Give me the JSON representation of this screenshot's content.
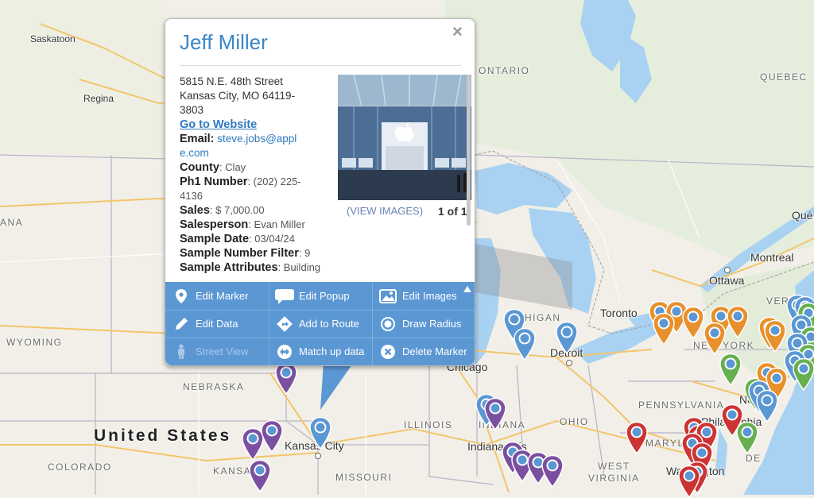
{
  "map": {
    "labels": {
      "saskatoon": "Saskatoon",
      "regina": "Regina",
      "ontario": "ONTARIO",
      "quebec": "QUEBEC",
      "que": "Qué",
      "montreal": "Montreal",
      "ottawa": "Ottawa",
      "toronto": "Toronto",
      "michigan": "HIGAN",
      "detroit": "Detroit",
      "chicago": "Chicago",
      "ver": "VER",
      "newyork": "NEW YORK",
      "wyoming": "WYOMING",
      "nebraska": "NEBRASKA",
      "ana": "ANA",
      "us": "United States",
      "colorado": "COLORADO",
      "kansas": "KANSA",
      "kansascity": "Kansas City",
      "missouri": "MISSOURI",
      "illinois": "ILLINOIS",
      "indiana": "INDIANA",
      "indianapolis": "Indianapolis",
      "ohio": "OHIO",
      "pennsylvania": "PENNSYLVANIA",
      "philadelphia": "Philadelphia",
      "maryland": "MARYLAND",
      "westvirginia_1": "WEST",
      "westvirginia_2": "VIRGINIA",
      "washington": "Washington",
      "ny_city": "Ne",
      "de": "DE"
    },
    "pin_colors": {
      "blue": "#5b97d3",
      "purple": "#7b4fa0",
      "orange": "#e8902c",
      "green": "#66b04f",
      "red": "#cc3333"
    }
  },
  "popup": {
    "title": "Jeff Miller",
    "close": "×",
    "address_line1": "5815 N.E. 48th Street",
    "address_line2": "Kansas City, MO 64119-",
    "address_line3": "3803",
    "website_label": "Go to Website",
    "email_label": "Email:",
    "email_value_1": "steve.jobs@appl",
    "email_value_2": "e.com",
    "county_label": "County",
    "county_value": ": Clay",
    "phone_label": "Ph1 Number",
    "phone_value": ": (202) 225-",
    "phone_value_2": "4136",
    "sales_label": "Sales",
    "sales_value": ": $ 7,000.00",
    "salesperson_label": "Salesperson",
    "salesperson_value": ": Evan Miller",
    "sample_date_label": "Sample Date",
    "sample_date_value": ": 03/04/24",
    "sample_number_label": "Sample Number Filter",
    "sample_number_value": ": 9",
    "sample_attr_label": "Sample Attributes",
    "sample_attr_value": ": Building & construction;Life",
    "view_images": "(VIEW IMAGES)",
    "image_count": "1 of 1",
    "toolbar": {
      "edit_marker": "Edit Marker",
      "edit_popup": "Edit Popup",
      "edit_images": "Edit Images",
      "edit_data": "Edit Data",
      "add_to_route": "Add to Route",
      "draw_radius": "Draw Radius",
      "street_view": "Street View",
      "match_up_data": "Match up data",
      "delete_marker": "Delete Marker"
    }
  }
}
